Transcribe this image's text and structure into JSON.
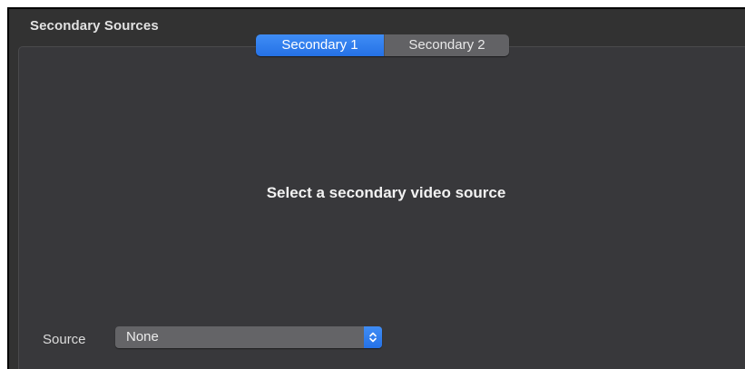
{
  "section": {
    "title": "Secondary Sources"
  },
  "tabs": [
    {
      "label": "Secondary 1",
      "selected": true
    },
    {
      "label": "Secondary 2",
      "selected": false
    }
  ],
  "main": {
    "message": "Select a secondary video source"
  },
  "source": {
    "label": "Source",
    "selected": "None",
    "icon": "chevron-up-down-icon"
  },
  "colors": {
    "accent": "#2f7ff0",
    "background": "#38383b"
  }
}
